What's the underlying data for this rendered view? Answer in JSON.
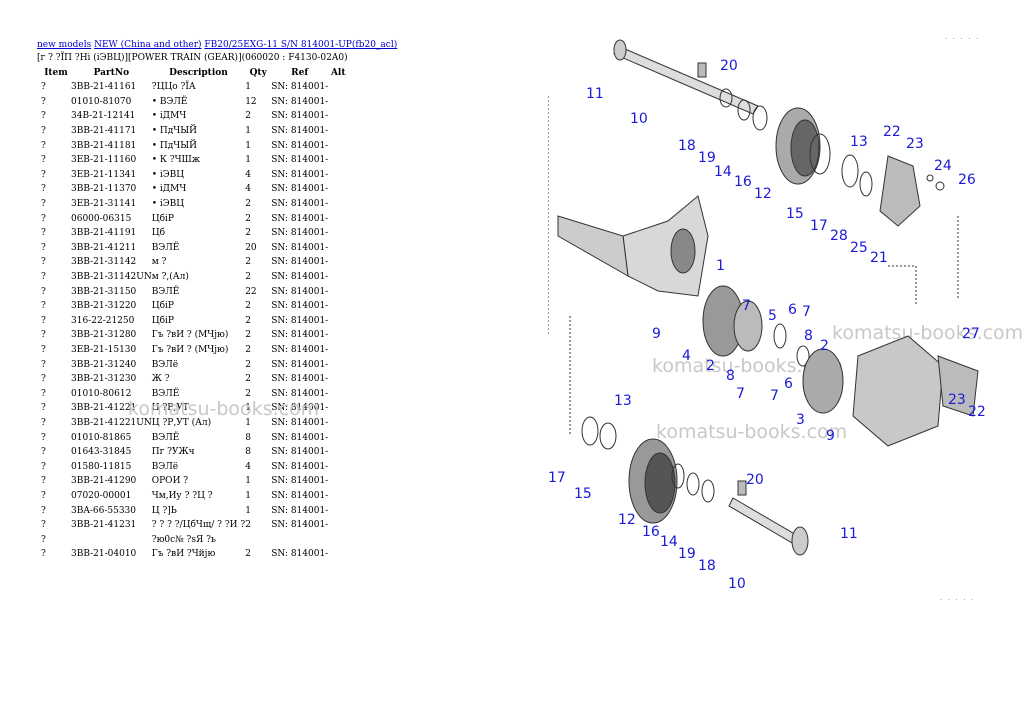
{
  "breadcrumb": [
    {
      "label": "new models"
    },
    {
      "label": "NEW (China and other)"
    },
    {
      "label": "FB20/25EXG-11 S/N 814001-UP(fb20_acl)"
    }
  ],
  "subtitle": "[г ? ?ЇП ?Нi (іЭВЦ)][POWER TRAIN (GEAR)](060020 : F4130-02A0)",
  "table": {
    "headers": {
      "item": "Item",
      "part": "PartNo",
      "desc": "Description",
      "qty": "Qty",
      "ref": "Ref",
      "alt": "Alt"
    },
    "rows": [
      {
        "item": "?",
        "part": "3BB-21-41161",
        "desc": "?ЦЦо ?ЇА",
        "qty": "1",
        "ref": "SN: 814001-"
      },
      {
        "item": "?",
        "part": "01010-81070",
        "desc": "• ВЭЛЁ",
        "qty": "12",
        "ref": "SN: 814001-"
      },
      {
        "item": "?",
        "part": "34B-21-12141",
        "desc": "• іДМЧ",
        "qty": "2",
        "ref": "SN: 814001-"
      },
      {
        "item": "?",
        "part": "3BB-21-41171",
        "desc": "• ПдЧЫЙ",
        "qty": "1",
        "ref": "SN: 814001-"
      },
      {
        "item": "?",
        "part": "3BB-21-41181",
        "desc": "• ПдЧЫЙ",
        "qty": "1",
        "ref": "SN: 814001-"
      },
      {
        "item": "?",
        "part": "3EB-21-11160",
        "desc": "• К ?ЧШж",
        "qty": "1",
        "ref": "SN: 814001-"
      },
      {
        "item": "?",
        "part": "3EB-21-11341",
        "desc": "• іЭВЦ",
        "qty": "4",
        "ref": "SN: 814001-"
      },
      {
        "item": "?",
        "part": "3BB-21-11370",
        "desc": "• іДМЧ",
        "qty": "4",
        "ref": "SN: 814001-"
      },
      {
        "item": "?",
        "part": "3EB-21-31141",
        "desc": "• іЭВЦ",
        "qty": "2",
        "ref": "SN: 814001-"
      },
      {
        "item": "?",
        "part": "06000-06315",
        "desc": "ЦбіР",
        "qty": "2",
        "ref": "SN: 814001-"
      },
      {
        "item": "?",
        "part": "3BB-21-41191",
        "desc": "Цб",
        "qty": "2",
        "ref": "SN: 814001-"
      },
      {
        "item": "?",
        "part": "3BB-21-41211",
        "desc": "ВЭЛЁ",
        "qty": "20",
        "ref": "SN: 814001-"
      },
      {
        "item": "?",
        "part": "3BB-21-31142",
        "desc": "м ?",
        "qty": "2",
        "ref": "SN: 814001-"
      },
      {
        "item": "?",
        "part": "3BB-21-31142UN",
        "desc": "м ?,(Ал)",
        "qty": "2",
        "ref": "SN: 814001-"
      },
      {
        "item": "?",
        "part": "3BB-21-31150",
        "desc": "ВЭЛЁ",
        "qty": "22",
        "ref": "SN: 814001-"
      },
      {
        "item": "?",
        "part": "3BB-21-31220",
        "desc": "ЦбіР",
        "qty": "2",
        "ref": "SN: 814001-"
      },
      {
        "item": "?",
        "part": "316-22-21250",
        "desc": "ЦбіР",
        "qty": "2",
        "ref": "SN: 814001-"
      },
      {
        "item": "?",
        "part": "3BB-21-31280",
        "desc": "Гъ ?вИ ? (МЧjю)",
        "qty": "2",
        "ref": "SN: 814001-"
      },
      {
        "item": "?",
        "part": "3EB-21-15130",
        "desc": "Гъ ?вИ ? (МЧjю)",
        "qty": "2",
        "ref": "SN: 814001-"
      },
      {
        "item": "?",
        "part": "3BB-21-31240",
        "desc": "ВЭЛё",
        "qty": "2",
        "ref": "SN: 814001-"
      },
      {
        "item": "?",
        "part": "3BB-21-31230",
        "desc": "Ж ?",
        "qty": "2",
        "ref": "SN: 814001-"
      },
      {
        "item": "?",
        "part": "01010-80612",
        "desc": "ВЭЛЁ",
        "qty": "2",
        "ref": "SN: 814001-"
      },
      {
        "item": "?",
        "part": "3BB-21-41221",
        "desc": "Ц ?Р,УТ",
        "qty": "1",
        "ref": "SN: 814001-"
      },
      {
        "item": "?",
        "part": "3BB-21-41221UN",
        "desc": "Ц ?Р,УТ (Ал)",
        "qty": "1",
        "ref": "SN: 814001-"
      },
      {
        "item": "?",
        "part": "01010-81865",
        "desc": "ВЭЛЁ",
        "qty": "8",
        "ref": "SN: 814001-"
      },
      {
        "item": "?",
        "part": "01643-31845",
        "desc": "Пг ?УЖч",
        "qty": "8",
        "ref": "SN: 814001-"
      },
      {
        "item": "?",
        "part": "01580-11815",
        "desc": "ВЭЛё",
        "qty": "4",
        "ref": "SN: 814001-"
      },
      {
        "item": "?",
        "part": "3BB-21-41290",
        "desc": "ОРОИ ?",
        "qty": "1",
        "ref": "SN: 814001-"
      },
      {
        "item": "?",
        "part": "07020-00001",
        "desc": "Чм,Иу ? ?Ц ?",
        "qty": "1",
        "ref": "SN: 814001-"
      },
      {
        "item": "?",
        "part": "3BA-66-55330",
        "desc": "Ц ?]Ь",
        "qty": "1",
        "ref": "SN: 814001-"
      },
      {
        "item": "?",
        "part": "3BB-21-41231",
        "desc": "? ? ? ?/ЦбЧщ/ ? ?И ?",
        "qty": "2",
        "ref": "SN: 814001-"
      },
      {
        "item": "?",
        "part": "",
        "desc": "?ю0с№ ?sЯ ?ь",
        "qty": "",
        "ref": ""
      },
      {
        "item": "?",
        "part": "3BB-21-04010",
        "desc": "Гъ ?вИ ?Чйjю",
        "qty": "2",
        "ref": "SN: 814001-"
      }
    ]
  },
  "watermark": "komatsu-books.com",
  "diagram": {
    "callouts": [
      "11",
      "20",
      "10",
      "18",
      "19",
      "14",
      "16",
      "12",
      "13",
      "22",
      "23",
      "24",
      "26",
      "15",
      "17",
      "28",
      "25",
      "21",
      "1",
      "9",
      "7",
      "5",
      "6",
      "7",
      "8",
      "4",
      "2",
      "8",
      "3",
      "6",
      "7",
      "7",
      "2",
      "27",
      "23",
      "22",
      "9",
      "13",
      "17",
      "15",
      "12",
      "16",
      "14",
      "19",
      "18",
      "20",
      "11",
      "10"
    ]
  }
}
